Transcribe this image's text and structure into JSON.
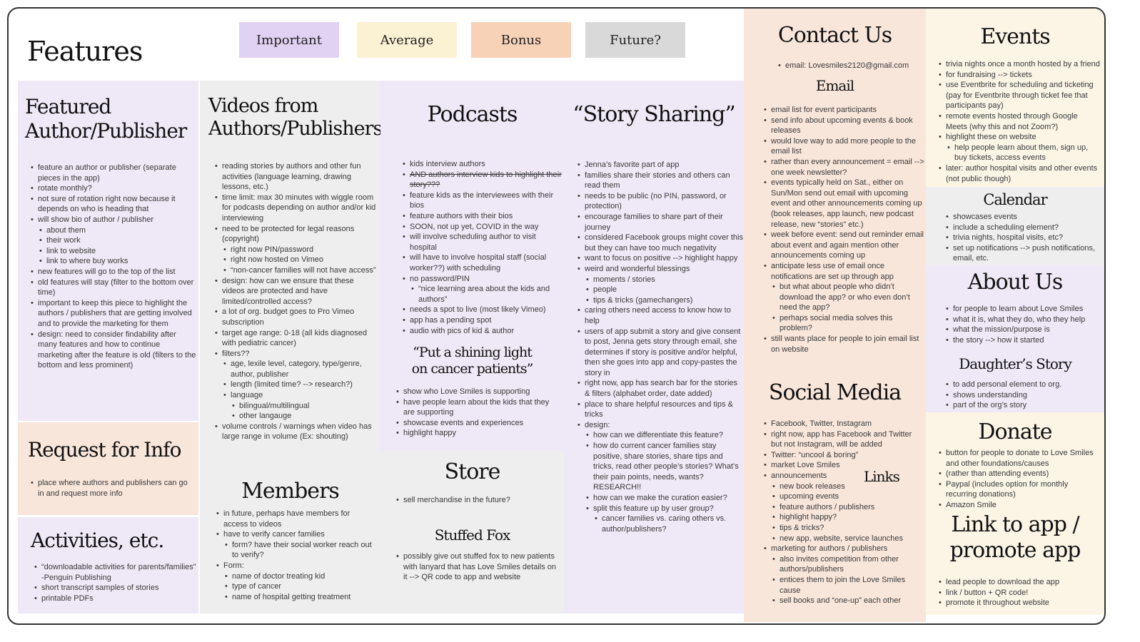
{
  "title": "Features",
  "legend": [
    {
      "label": "Important",
      "color": "#e0d2f2"
    },
    {
      "label": "Average",
      "color": "#fbf1d3"
    },
    {
      "label": "Bonus",
      "color": "#f7d2b6"
    },
    {
      "label": "Future?",
      "color": "#d9d9d9"
    }
  ],
  "colors": {
    "important": "#efe8f7",
    "average": "#fcf5e6",
    "bonus": "#f9e6da",
    "future": "#eeeeee"
  },
  "panels": [
    {
      "blocks": [
        {
          "heading": "Featured\nAuthor/Publisher",
          "items": [
            "feature an author or publisher (separate pieces in the app)",
            "rotate monthly?",
            "not sure of rotation right now because it depends on who is heading that",
            {
              "text": "will show bio of author / publisher",
              "children": [
                "about them",
                "their work",
                "link to website",
                "link to where buy works"
              ]
            },
            "new features will go to the top of the list",
            "old features will stay (filter to the bottom over time)",
            "important to keep this piece to highlight the authors / publishers that are getting involved and to provide the marketing for them",
            "design: need to consider findability after many features and how to continue marketing after the feature is old (filters to the bottom and less prominent)"
          ]
        }
      ]
    },
    {
      "blocks": [
        {
          "heading": "Request for Info",
          "items": [
            "place where authors and publishers can go in and request more info"
          ]
        }
      ]
    },
    {
      "blocks": [
        {
          "heading": "Activities, etc.",
          "items": [
            "“downloadable activities for parents/families” -Penguin Publishing",
            "short transcript samples of stories",
            "printable PDFs"
          ]
        }
      ]
    },
    {
      "blocks": [
        {
          "heading": "Videos from\nAuthors/Publishers",
          "items": [
            "reading stories by authors and other fun activities (language learning, drawing lessons, etc.)",
            "time limit: max 30 minutes with wiggle room for podcasts depending on author and/or kid interviewing",
            {
              "text": "need to be protected for legal reasons (copyright)",
              "children": [
                "right now PIN/password",
                "right now hosted on Vimeo",
                "“non-cancer families will not have access”"
              ]
            },
            "design: how can we ensure that these videos are protected and have limited/controlled access?",
            "a lot of org. budget goes to Pro Vimeo subscription",
            "target age range: 0-18 (all kids diagnosed with pediatric cancer)",
            {
              "text": "filters??",
              "children": [
                "age, lexile level, category, type/genre, author, publisher",
                "length (limited time? --> research?)",
                {
                  "text": "language",
                  "children": [
                    "bilingual/multilingual",
                    "other langauge"
                  ]
                }
              ]
            },
            "volume controls / warnings when video has large range in volume (Ex: shouting)"
          ]
        },
        {
          "heading": "Members",
          "items": [
            "in future, perhaps have members for access to videos",
            {
              "text": "have to verify cancer families",
              "children": [
                "form? have their social worker reach out to verify?"
              ]
            },
            {
              "text": "Form:",
              "children": [
                "name of doctor treating kid",
                "type of cancer",
                "name of hospital getting treatment"
              ]
            }
          ]
        }
      ]
    },
    {
      "blocks": [
        {
          "heading": "Podcasts",
          "items": [
            "kids interview authors",
            {
              "text": "AND authors interview kids to highlight their story???",
              "strike": true
            },
            "feature kids as the interviewees with their bios",
            "feature authors with their bios",
            "SOON, not up yet, COVID in the way",
            "will involve scheduling author to visit hospital",
            "will have to involve hospital staff (social worker??) with scheduling",
            {
              "text": "no password/PIN",
              "children": [
                "“nice learning area about the kids and authors”"
              ]
            },
            "needs a spot to live (most likely Vimeo)",
            "app has a pending spot",
            "audio with pics of kid & author"
          ]
        },
        {
          "heading": "“Put a shining light\non cancer patients”",
          "items": [
            "show who Love Smiles is supporting",
            "have people learn about the kids that they are supporting",
            "showcase events and experiences",
            "highlight happy"
          ]
        }
      ]
    },
    {
      "blocks": [
        {
          "heading": "Store",
          "items": [
            "sell merchandise in the future?"
          ]
        },
        {
          "heading": "Stuffed Fox",
          "items": [
            "possibly give out stuffed fox to new patients with lanyard that has Love Smiles details on it --> QR code to app and website"
          ]
        }
      ]
    },
    {
      "blocks": [
        {
          "heading": "“Story Sharing”",
          "items": [
            "Jenna’s favorite part of app",
            "families share their stories and others can read them",
            "needs to be public (no PIN, password, or protection)",
            "encourage families to share part of their journey",
            "considered Facebook groups might cover this but they can have too much negativity",
            "want to focus on positive --> highlight happy",
            {
              "text": "weird and wonderful blessings",
              "children": [
                "moments / stories",
                "people",
                "tips & tricks (gamechangers)"
              ]
            },
            "caring others need access to know how to help",
            "users of app submit a story and give consent to post, Jenna gets story through email, she determines if story is positive and/or helpful, then she goes into app and copy-pastes the story in",
            "right now, app has search bar for the stories & filters (alphabet order, date added)",
            "place to share helpful resources and tips & tricks",
            {
              "text": "design:",
              "children": [
                "how can we differentiate this feature?",
                "how do current cancer families stay positive, share stories, share tips and tricks, read other people’s stories? What’s their pain points, needs, wants? RESEARCH!!",
                "how can we make the curation easier?",
                {
                  "text": "split this feature up by user group?",
                  "children": [
                    "cancer families vs. caring others vs. author/publishers?"
                  ]
                }
              ]
            }
          ]
        }
      ]
    },
    {
      "blocks": [
        {
          "heading": "Contact Us",
          "items": [
            "email: Lovesmiles2120@gmail.com"
          ]
        },
        {
          "heading": "Email",
          "items": [
            "email list for event participants",
            "send info about upcoming events & book releases",
            "would love way to add more people to the email list",
            "rather than every announcement = email --> one week newsletter?",
            "events typically held on Sat., either on Sun/Mon send out email with upcoming event and other announcements coming up (book releases, app launch, new podcast release, new “stories” etc.)",
            "week before event: send out reminder email about event and again mention other announcements coming up",
            {
              "text": "anticipate less use of email once notifications are set up through app",
              "children": [
                "but what about people who didn’t download the app? or who even don’t need the app?",
                "perhaps social media solves this problem?"
              ]
            },
            "still wants place for people to join email list on website"
          ]
        },
        {
          "heading": "Social Media",
          "items": [
            "Facebook, Twitter, Instagram",
            "right now, app has Facebook and Twitter but not Instagram, will be added",
            "Twitter: “uncool & boring”",
            "market Love Smiles",
            {
              "text": "announcements",
              "children": [
                "new book releases",
                "upcoming events",
                "feature authors / publishers",
                "highlight happy?",
                "tips & tricks?",
                "new app, website, service launches"
              ]
            },
            {
              "text": "marketing for authors / publishers",
              "children": [
                "also invites competition from other authors/publishers",
                "entices them to join the Love Smiles cause",
                "sell books and “one-up” each other"
              ]
            }
          ]
        },
        {
          "heading": "Links",
          "items": []
        }
      ]
    },
    {
      "blocks": [
        {
          "heading": "Events",
          "items": [
            "trivia nights once a month hosted by a friend",
            "for fundraising --> tickets",
            "use Eventbrite for scheduling and ticketing (pay for Eventbrite through ticket fee that participants pay)",
            "remote events hosted through Google Meets (why this and not Zoom?)",
            {
              "text": "highlight these on website",
              "children": [
                "help people learn about them, sign up, buy tickets, access events"
              ]
            },
            "later: author hospital visits and other events (not public though)"
          ]
        }
      ]
    },
    {
      "blocks": [
        {
          "heading": "Calendar",
          "items": [
            "showcases events",
            "include a scheduling element?",
            "trivia nights, hospital visits, etc?",
            "set up notifications --> push notifications, email, etc."
          ]
        }
      ]
    },
    {
      "blocks": [
        {
          "heading": "About Us",
          "items": [
            "for people to learn about Love Smiles",
            "what it is, what they do, who they help",
            "what the mission/purpose is",
            "the story --> how it started"
          ]
        },
        {
          "heading": "Daughter’s Story",
          "items": [
            "to add personal element to org.",
            "shows understanding",
            "part of the org’s story"
          ]
        }
      ]
    },
    {
      "blocks": [
        {
          "heading": "Donate",
          "items": [
            "button for people to donate to Love Smiles and other foundations/causes",
            "(rather than attending events)",
            "Paypal (includes option for monthly recurring donations)",
            "Amazon Smile"
          ]
        },
        {
          "heading": "Link to app /\npromote app",
          "items": [
            "lead people to download the app",
            "link / button + QR code!",
            "promote it throughout website"
          ]
        }
      ]
    }
  ]
}
